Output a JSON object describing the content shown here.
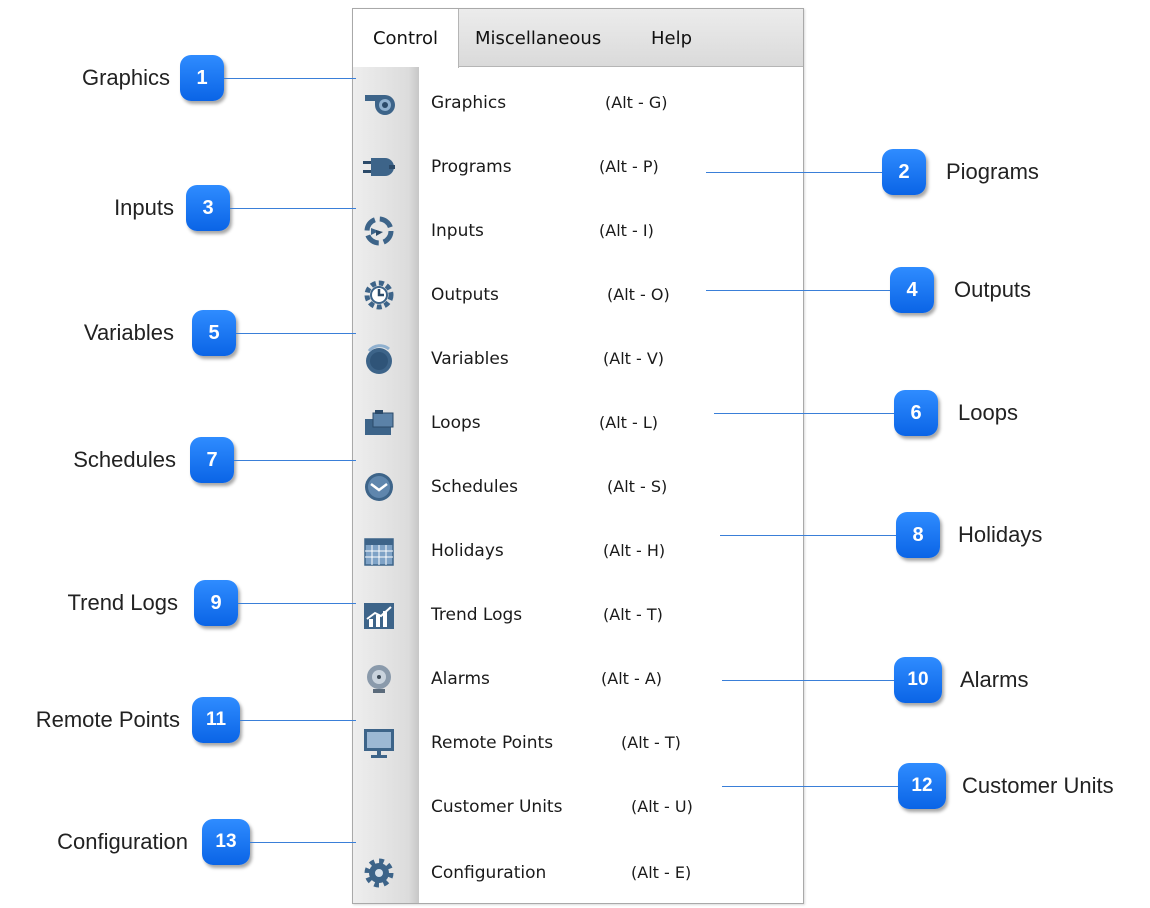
{
  "menubar": {
    "tabs": [
      {
        "label": "Control",
        "active": true
      },
      {
        "label": "Miscellaneous",
        "active": false
      },
      {
        "label": "Help",
        "active": false
      }
    ]
  },
  "menu_items": [
    {
      "label": "Graphics",
      "shortcut": "(Alt - G)",
      "icon": "fan-blower-icon"
    },
    {
      "label": "Programs",
      "shortcut": "(Alt - P)",
      "icon": "plug-icon"
    },
    {
      "label": "Inputs",
      "shortcut": "(Alt - I)",
      "icon": "input-arrows-icon"
    },
    {
      "label": "Outputs",
      "shortcut": "(Alt - O)",
      "icon": "gear-clock-icon"
    },
    {
      "label": "Variables",
      "shortcut": "(Alt - V)",
      "icon": "dial-knob-icon"
    },
    {
      "label": "Loops",
      "shortcut": "(Alt - L)",
      "icon": "folder-loop-icon"
    },
    {
      "label": "Schedules",
      "shortcut": "(Alt - S)",
      "icon": "clock-icon"
    },
    {
      "label": "Holidays",
      "shortcut": "(Alt - H)",
      "icon": "calendar-icon"
    },
    {
      "label": "Trend Logs",
      "shortcut": "(Alt - T)",
      "icon": "trend-chart-icon"
    },
    {
      "label": "Alarms",
      "shortcut": "(Alt - A)",
      "icon": "alarm-bell-icon"
    },
    {
      "label": "Remote Points",
      "shortcut": "(Alt - T)",
      "icon": "monitor-icon"
    },
    {
      "label": "Customer Units",
      "shortcut": "(Alt - U)",
      "icon": ""
    },
    {
      "label": "Configuration",
      "shortcut": "(Alt - E)",
      "icon": "settings-gear-icon"
    }
  ],
  "callouts": [
    {
      "number": "1",
      "text": "Graphics",
      "side": "left"
    },
    {
      "number": "2",
      "text": "Piograms",
      "side": "right"
    },
    {
      "number": "3",
      "text": "Inputs",
      "side": "left"
    },
    {
      "number": "4",
      "text": "Outputs",
      "side": "right"
    },
    {
      "number": "5",
      "text": "Variables",
      "side": "left"
    },
    {
      "number": "6",
      "text": "Loops",
      "side": "right"
    },
    {
      "number": "7",
      "text": "Schedules",
      "side": "left"
    },
    {
      "number": "8",
      "text": "Holidays",
      "side": "right"
    },
    {
      "number": "9",
      "text": "Trend Logs",
      "side": "left"
    },
    {
      "number": "10",
      "text": "Alarms",
      "side": "right"
    },
    {
      "number": "11",
      "text": "Remote Points",
      "side": "left"
    },
    {
      "number": "12",
      "text": "Customer Units",
      "side": "right"
    },
    {
      "number": "13",
      "text": "Configuration",
      "side": "left"
    }
  ],
  "colors": {
    "badge": "#1a73ee",
    "leader_line": "#3a7fd8",
    "icon_blue": "#3d6489"
  }
}
